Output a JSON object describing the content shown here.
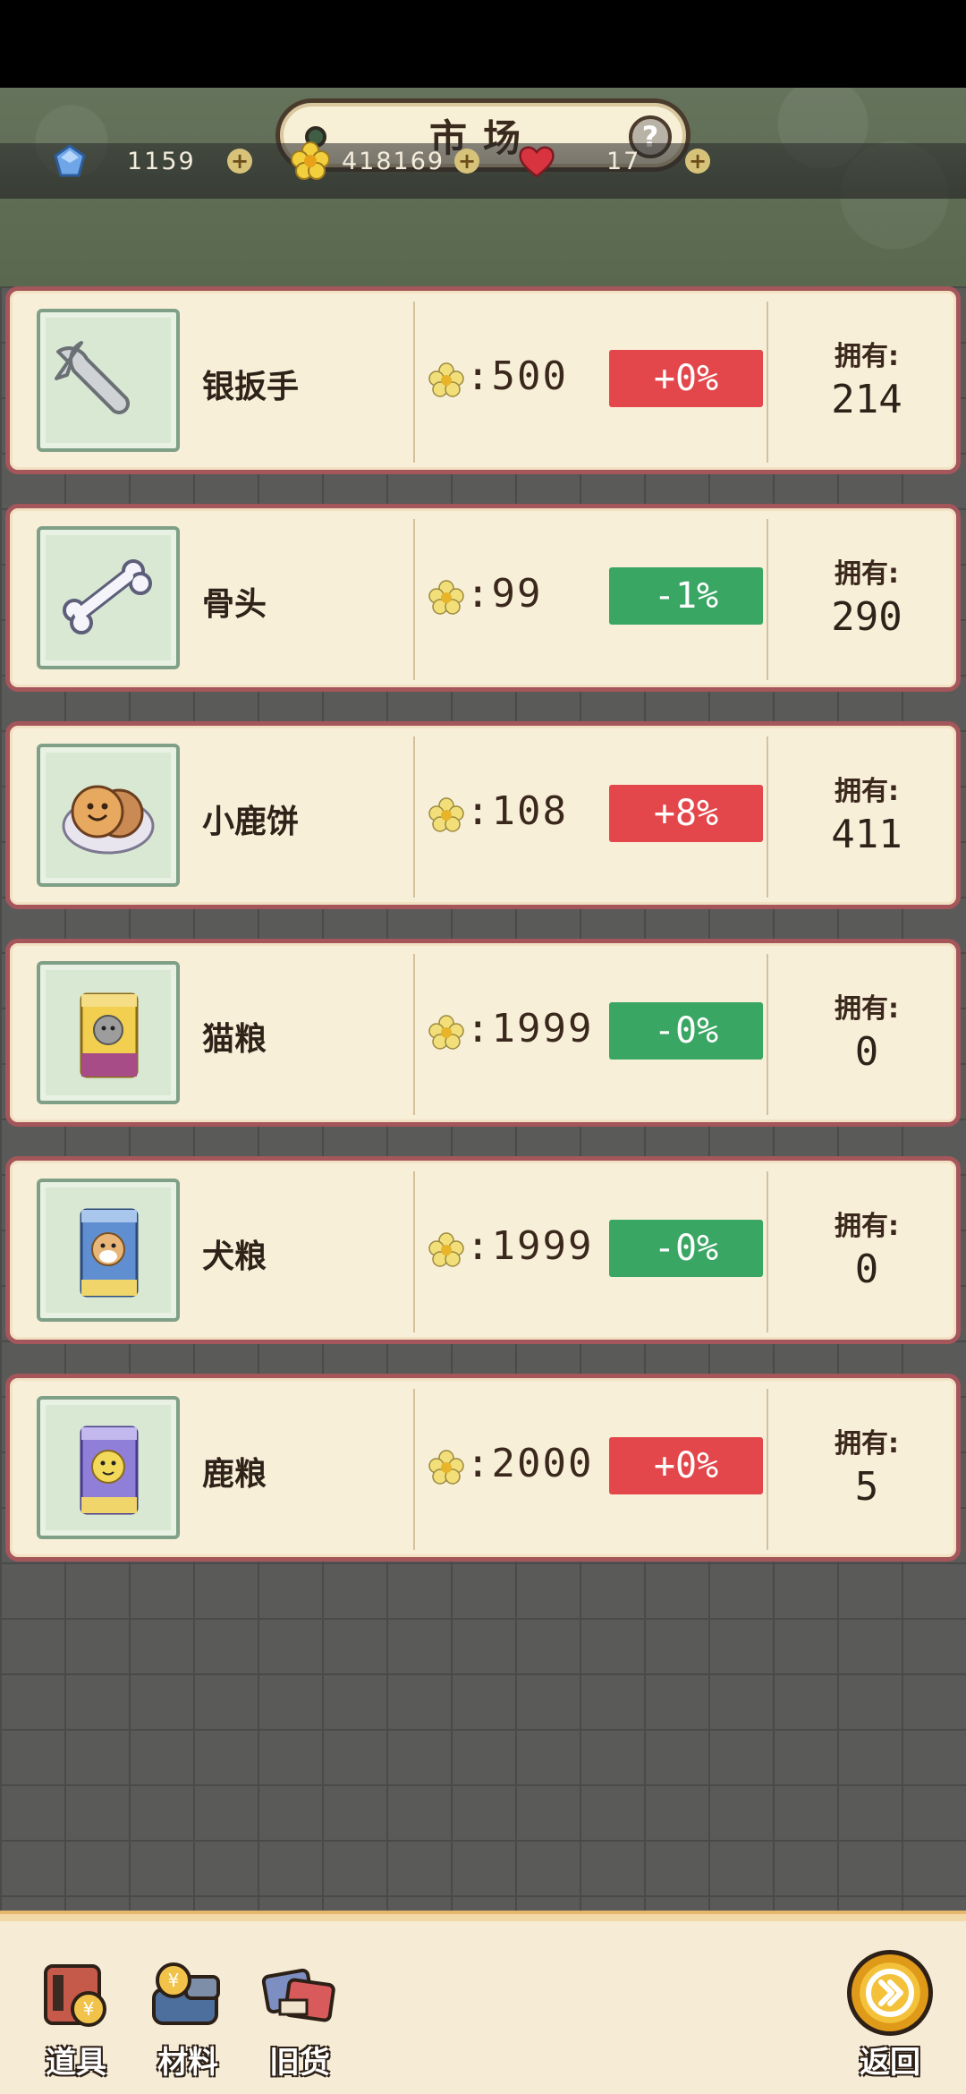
{
  "header": {
    "title": "市场",
    "help_symbol": "?"
  },
  "resources": [
    {
      "icon": "blue-gem-icon",
      "value": "1159"
    },
    {
      "icon": "yellow-flower-icon",
      "value": "418169"
    },
    {
      "icon": "red-heart-icon",
      "value": "17"
    }
  ],
  "own_label": "拥有:",
  "items": [
    {
      "name": "银扳手",
      "icon": "wrench-icon",
      "price": ":500",
      "change": "+0%",
      "trend": "up",
      "owned": "214"
    },
    {
      "name": "骨头",
      "icon": "bone-icon",
      "price": ":99",
      "change": "-1%",
      "trend": "down",
      "owned": "290"
    },
    {
      "name": "小鹿饼",
      "icon": "cookie-icon",
      "price": ":108",
      "change": "+8%",
      "trend": "up",
      "owned": "411"
    },
    {
      "name": "猫粮",
      "icon": "cat-food-icon",
      "price": ":1999",
      "change": "-0%",
      "trend": "down",
      "owned": "0"
    },
    {
      "name": "犬粮",
      "icon": "dog-food-icon",
      "price": ":1999",
      "change": "-0%",
      "trend": "down",
      "owned": "0"
    },
    {
      "name": "鹿粮",
      "icon": "deer-food-icon",
      "price": ":2000",
      "change": "+0%",
      "trend": "up",
      "owned": "5"
    }
  ],
  "bottom_nav": [
    {
      "label": "道具",
      "icon": "tools-icon"
    },
    {
      "label": "材料",
      "icon": "materials-icon"
    },
    {
      "label": "旧货",
      "icon": "second-hand-icon"
    }
  ],
  "return_label": "返回",
  "colors": {
    "up": "#e3474b",
    "down": "#3aa663",
    "row_border": "#a4565b",
    "row_bg": "#f8efd9"
  }
}
